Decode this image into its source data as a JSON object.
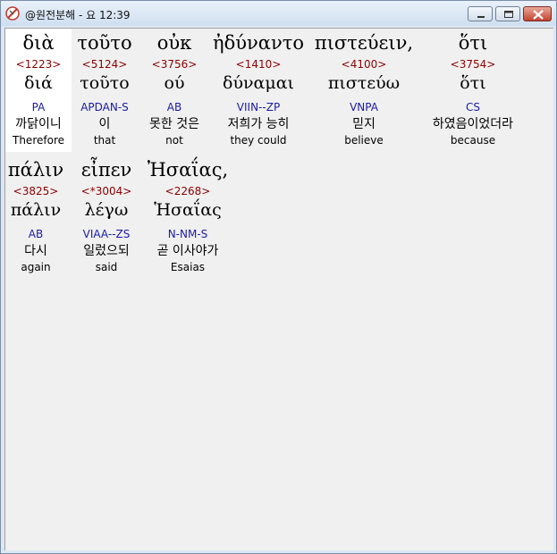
{
  "window": {
    "title": "@원전분해 - 요 12:39",
    "accent": "#dce7f3",
    "icons": {
      "app": "cross-app-icon",
      "minimize": "minimize-icon",
      "maximize": "maximize-icon",
      "close": "close-icon"
    }
  },
  "verse": {
    "words": [
      {
        "greek": "διὰ",
        "strongs": "<1223>",
        "lemma": "διά",
        "morph": "PA",
        "korean": "까닭이니",
        "english": "Therefore"
      },
      {
        "greek": "τοῦτο",
        "strongs": "<5124>",
        "lemma": "τοῦτο",
        "morph": "APDAN-S",
        "korean": "이",
        "english": "that"
      },
      {
        "greek": "οὐκ",
        "strongs": "<3756>",
        "lemma": "ού",
        "morph": "AB",
        "korean": "못한 것은",
        "english": "not"
      },
      {
        "greek": "ἠδύναντο",
        "strongs": "<1410>",
        "lemma": "δύναμαι",
        "morph": "VIIN--ZP",
        "korean": "저희가 능히",
        "english": "they could"
      },
      {
        "greek": "πιστεύειν,",
        "strongs": "<4100>",
        "lemma": "πιστεύω",
        "morph": "VNPA",
        "korean": "믿지",
        "english": "believe"
      },
      {
        "greek": "ὅτι",
        "strongs": "<3754>",
        "lemma": "ὅτι",
        "morph": "CS",
        "korean": "하였음이었더라",
        "english": "because"
      },
      {
        "greek": "πάλιν",
        "strongs": "<3825>",
        "lemma": "πάλιν",
        "morph": "AB",
        "korean": "다시",
        "english": "again"
      },
      {
        "greek": "εἶπεν",
        "strongs": "<*3004>",
        "lemma": "λέγω",
        "morph": "VIAA--ZS",
        "korean": "일렀으되",
        "english": "said"
      },
      {
        "greek": "Ἠσαΐας,",
        "strongs": "<2268>",
        "lemma": "Ἡσαΐας",
        "morph": "N-NM-S",
        "korean": "곧 이사야가",
        "english": "Esaias"
      }
    ]
  }
}
